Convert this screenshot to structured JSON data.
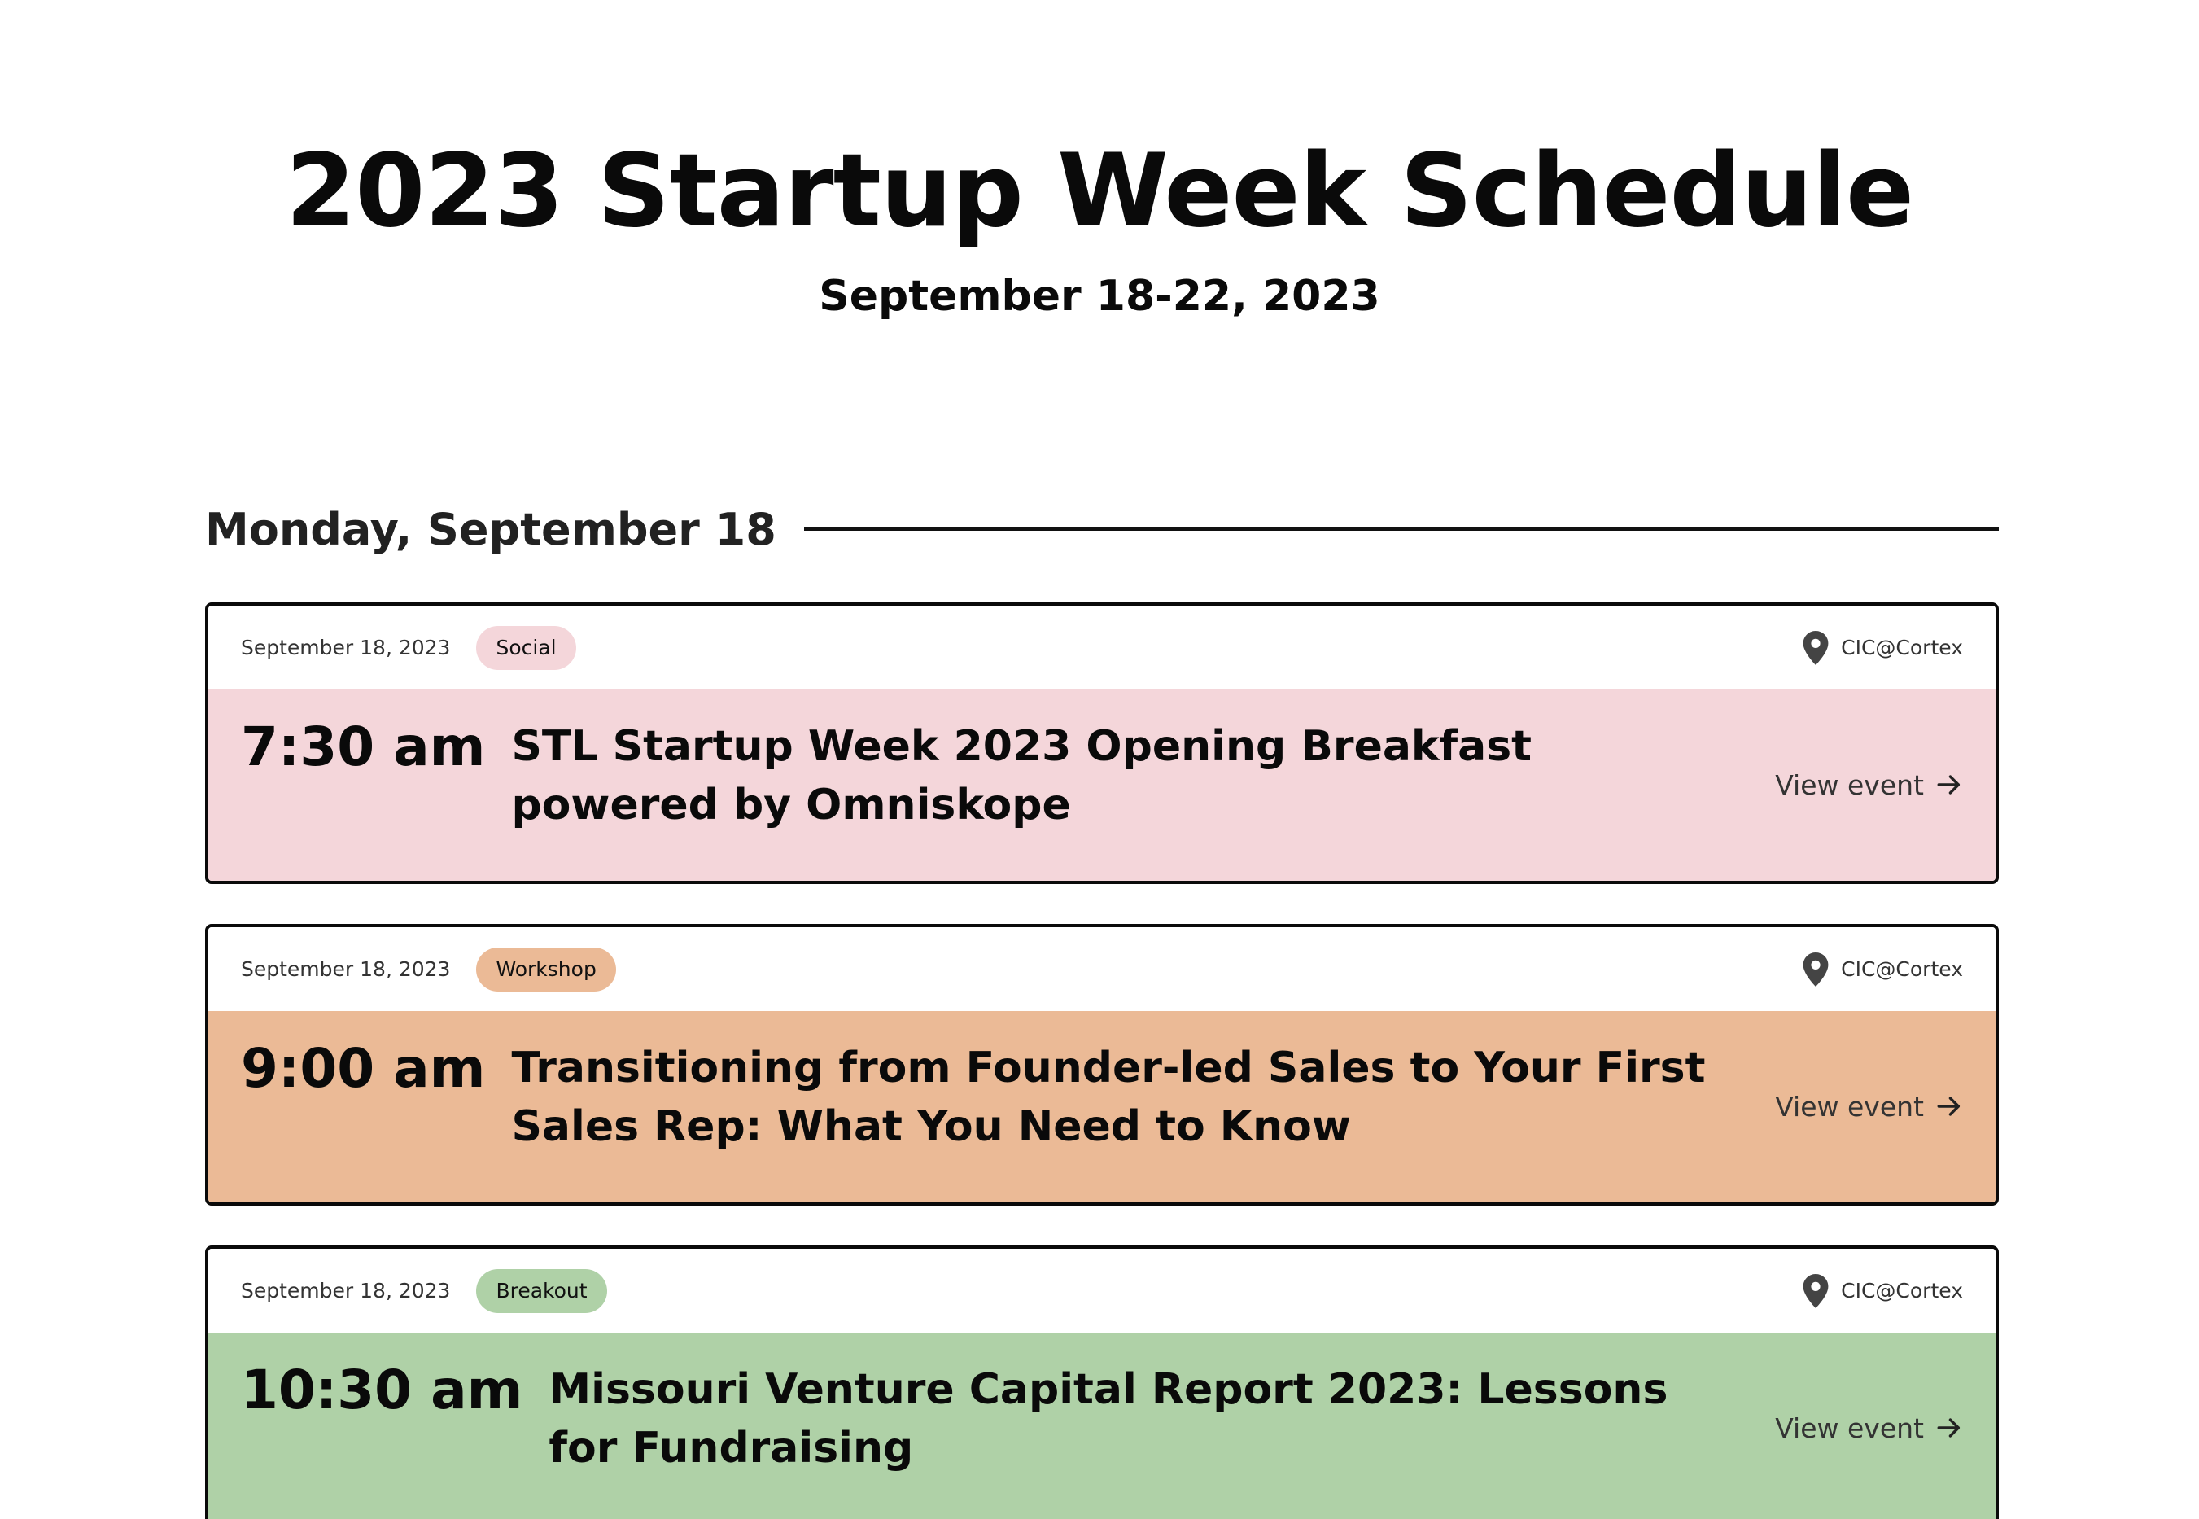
{
  "header": {
    "title": "2023 Startup Week Schedule",
    "dates": "September 18-22, 2023"
  },
  "day": {
    "label": "Monday, September 18"
  },
  "events": [
    {
      "date": "September 18, 2023",
      "category": "Social",
      "category_color": "#f4d6da",
      "location": "CIC@Cortex",
      "time": "7:30 am",
      "title": "STL Startup Week 2023 Opening Breakfast powered by Omniskope",
      "link_label": "View event",
      "body_color": "#f4d6da"
    },
    {
      "date": "September 18, 2023",
      "category": "Workshop",
      "category_color": "#ebba96",
      "location": "CIC@Cortex",
      "time": "9:00 am",
      "title": "Transitioning from Founder-led Sales to Your First Sales Rep: What You Need to Know",
      "link_label": "View event",
      "body_color": "#ebba96"
    },
    {
      "date": "September 18, 2023",
      "category": "Breakout",
      "category_color": "#afd1a7",
      "location": "CIC@Cortex",
      "time": "10:30 am",
      "title": "Missouri Venture Capital Report 2023: Lessons for Fundraising",
      "link_label": "View event",
      "body_color": "#afd1a7"
    }
  ],
  "icons": {
    "location": "map-pin-icon",
    "arrow": "arrow-right-icon"
  }
}
